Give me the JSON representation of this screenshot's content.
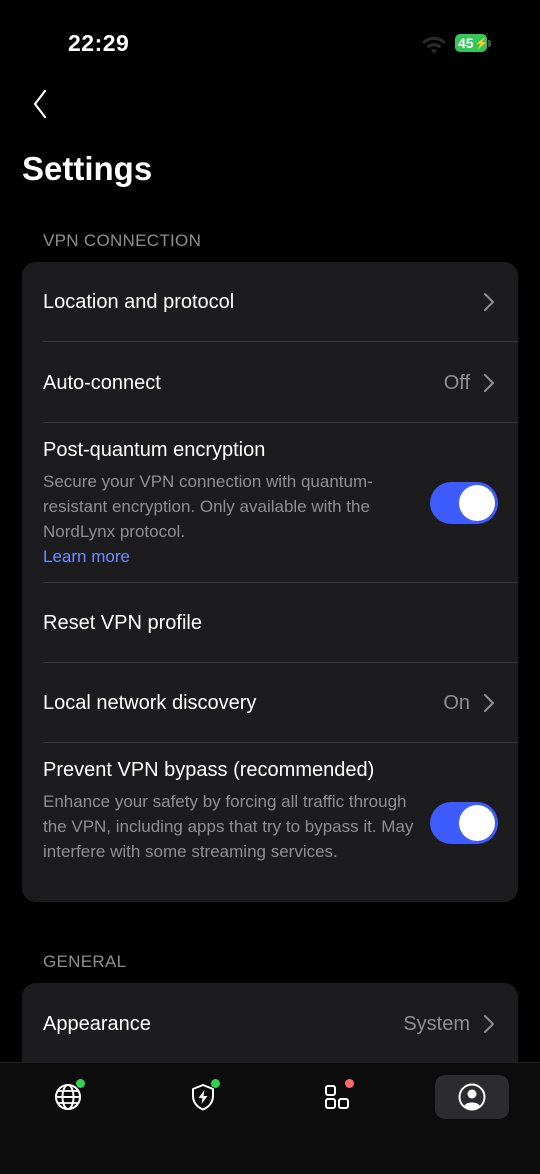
{
  "status_bar": {
    "time": "22:29",
    "battery_level": "45",
    "battery_color": "#34c759"
  },
  "header": {
    "back_icon": "chevron-left-icon",
    "title": "Settings"
  },
  "sections": {
    "vpn": {
      "header": "VPN CONNECTION",
      "rows": {
        "location": {
          "title": "Location and protocol"
        },
        "auto_connect": {
          "title": "Auto-connect",
          "value": "Off"
        },
        "post_quantum": {
          "title": "Post-quantum encryption",
          "description": "Secure your VPN connection with quantum-resistant encryption. Only available with the NordLynx protocol.",
          "link": "Learn more",
          "toggle_on": true
        },
        "reset": {
          "title": "Reset VPN profile"
        },
        "local_network": {
          "title": "Local network discovery",
          "value": "On"
        },
        "prevent_bypass": {
          "title": "Prevent VPN bypass (recommended)",
          "description": "Enhance your safety by forcing all traffic through the VPN, including apps that try to bypass it. May interfere with some streaming services.",
          "toggle_on": true
        }
      }
    },
    "general": {
      "header": "GENERAL",
      "rows": {
        "appearance": {
          "title": "Appearance",
          "value": "System"
        }
      }
    }
  },
  "tab_bar": {
    "tabs": [
      {
        "icon": "globe-icon",
        "dot_color": "#30d158",
        "active": false
      },
      {
        "icon": "shield-bolt-icon",
        "dot_color": "#30d158",
        "active": false
      },
      {
        "icon": "apps-grid-icon",
        "dot_color": "#ff6b6b",
        "active": false
      },
      {
        "icon": "profile-icon",
        "dot_color": "",
        "active": true
      }
    ]
  },
  "colors": {
    "accent": "#3e5bff",
    "link": "#6b8cff",
    "card_bg": "#1c1c1e",
    "secondary_text": "#8e8e93"
  }
}
